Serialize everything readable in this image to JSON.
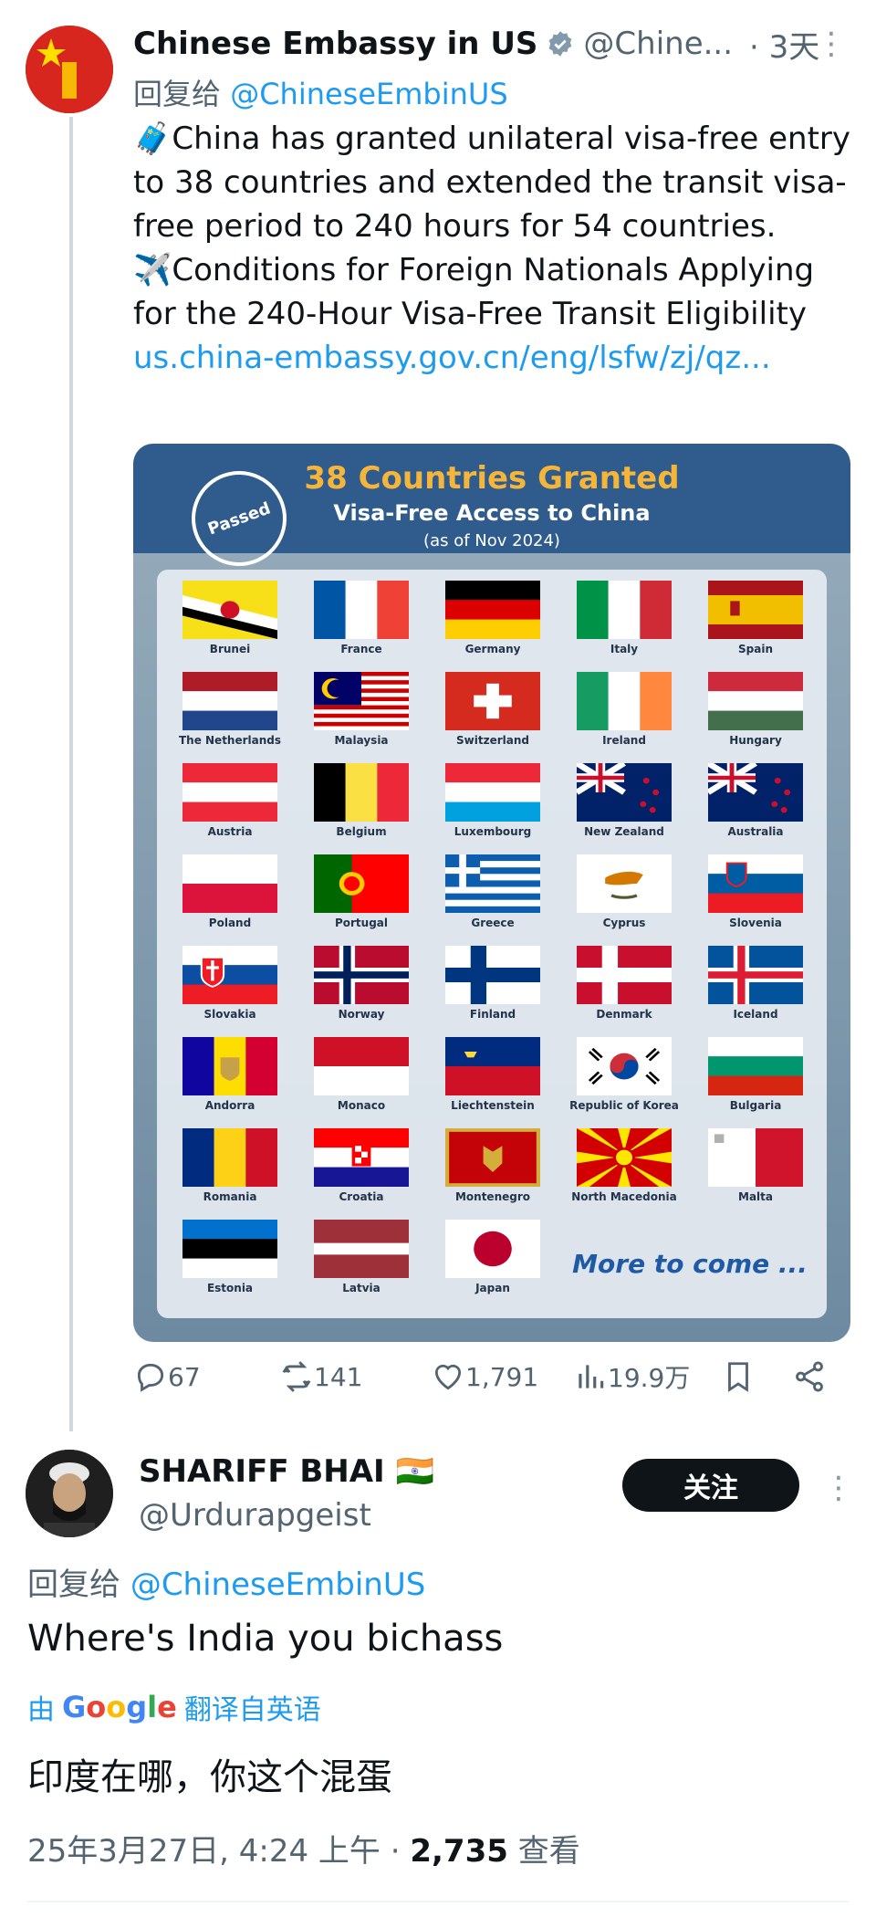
{
  "tweet": {
    "author_name": "Chinese Embassy in US",
    "author_handle": "@Chine...",
    "time": "· 3天",
    "reply_prefix": "回复给",
    "reply_target": "@ChineseEmbinUS",
    "line1": "🧳China has granted unilateral visa-free entry to 38 countries and extended the transit visa-free period to 240 hours for 54 countries.",
    "line2": "✈️Conditions for Foreign Nationals Applying for the 240-Hour Visa-Free Transit Eligibility",
    "url": "us.china-embassy.gov.cn/eng/lsfw/zj/qz..."
  },
  "media": {
    "title": "38 Countries Granted",
    "subtitle": "Visa-Free Access to China",
    "date": "(as of Nov 2024)",
    "stamp": "Passed",
    "more": "More to come ...",
    "countries": [
      "Brunei",
      "France",
      "Germany",
      "Italy",
      "Spain",
      "The Netherlands",
      "Malaysia",
      "Switzerland",
      "Ireland",
      "Hungary",
      "Austria",
      "Belgium",
      "Luxembourg",
      "New Zealand",
      "Australia",
      "Poland",
      "Portugal",
      "Greece",
      "Cyprus",
      "Slovenia",
      "Slovakia",
      "Norway",
      "Finland",
      "Denmark",
      "Iceland",
      "Andorra",
      "Monaco",
      "Liechtenstein",
      "Republic of Korea",
      "Bulgaria",
      "Romania",
      "Croatia",
      "Montenegro",
      "North Macedonia",
      "Malta",
      "Estonia",
      "Latvia",
      "Japan"
    ]
  },
  "actions": {
    "replies": "67",
    "retweets": "141",
    "likes": "1,791",
    "views": "19.9万"
  },
  "reply": {
    "author_name": "SHARIFF BHAI 🇮🇳",
    "author_handle": "@Urdurapgeist",
    "follow_label": "关注",
    "reply_prefix": "回复给",
    "reply_target": "@ChineseEmbinUS",
    "text": "Where's India you bichass",
    "translate_prefix": "由",
    "translate_suffix": "翻译自英语",
    "translated": "印度在哪，你这个混蛋",
    "timestamp": "25年3月27日, 4:24 上午 · ",
    "views_count": "2,735",
    "views_label": " 查看"
  },
  "colors": {
    "link": "#1d9bf0",
    "muted": "#536471",
    "text": "#0f1419"
  },
  "icons": [
    "verified-badge-icon",
    "more-icon",
    "reply-icon",
    "retweet-icon",
    "like-icon",
    "views-icon",
    "bookmark-icon",
    "share-icon"
  ]
}
